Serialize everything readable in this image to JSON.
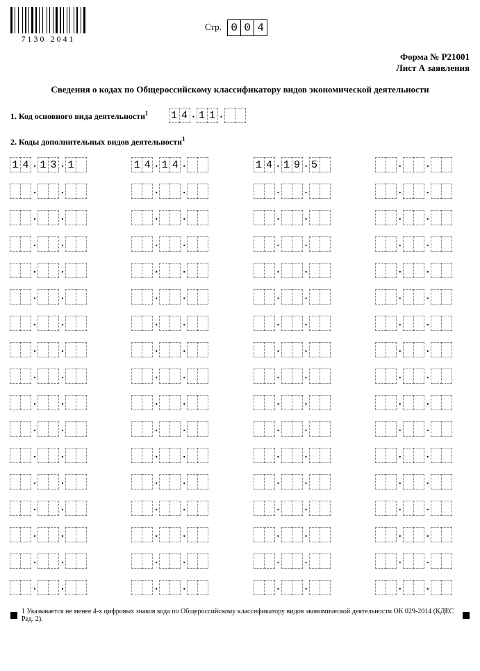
{
  "barcode_number": "7130 2041",
  "page_label": "Стр.",
  "page_number": [
    "0",
    "0",
    "4"
  ],
  "form_line1": "Форма № Р21001",
  "form_line2": "Лист А заявления",
  "section_title": "Сведения о кодах по Общероссийскому классификатору видов экономической деятельности",
  "label_main": "1. Код основного вида деятельности",
  "label_additional": "2. Коды дополнительных видов деятельности",
  "sup": "1",
  "main_code": {
    "a": [
      "1",
      "4"
    ],
    "b": [
      "1",
      "1"
    ],
    "c": [
      "",
      ""
    ]
  },
  "add_codes": [
    {
      "a": [
        "1",
        "4"
      ],
      "b": [
        "1",
        "3"
      ],
      "c": [
        "1",
        ""
      ]
    },
    {
      "a": [
        "1",
        "4"
      ],
      "b": [
        "1",
        "4"
      ],
      "c": [
        "",
        ""
      ]
    },
    {
      "a": [
        "1",
        "4"
      ],
      "b": [
        "1",
        "9"
      ],
      "c": [
        "5",
        ""
      ]
    }
  ],
  "total_slots": 68,
  "dot": ".",
  "footnote": "1 Указывается не менее 4-х цифровых знаков кода по Общероссийскому классификатору видов экономической деятельности ОК 029-2014 (КДЕС Ред. 2)."
}
